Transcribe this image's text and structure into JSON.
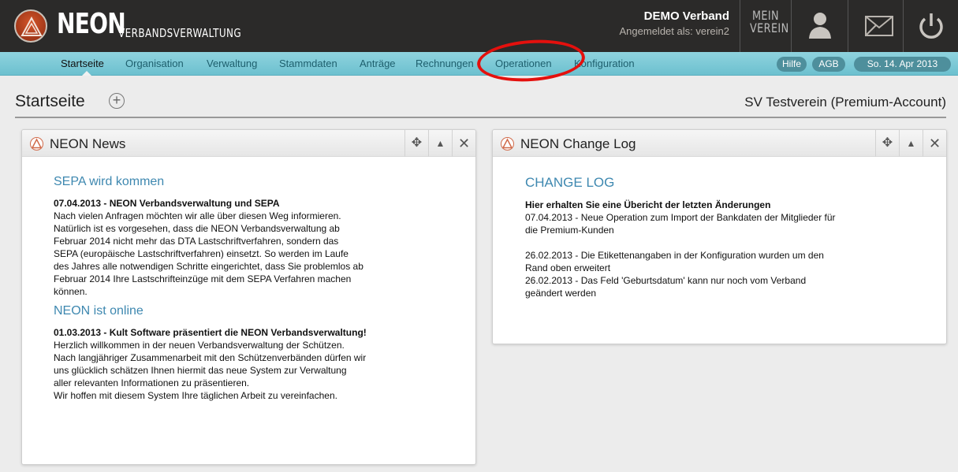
{
  "header": {
    "brand": "NEON",
    "brand_sub": "VERBANDSVERWALTUNG",
    "org_name": "DEMO Verband",
    "login_info": "Angemeldet als: verein2",
    "mein_verein": "MEIN VEREIN",
    "icons": [
      "neon-logo",
      "user-icon",
      "mail-icon",
      "power-icon"
    ]
  },
  "nav": {
    "items": [
      {
        "label": "Startseite",
        "active": true
      },
      {
        "label": "Organisation"
      },
      {
        "label": "Verwaltung"
      },
      {
        "label": "Stammdaten"
      },
      {
        "label": "Anträge"
      },
      {
        "label": "Rechnungen"
      },
      {
        "label": "Operationen"
      },
      {
        "label": "Konfiguration"
      }
    ],
    "help": "Hilfe",
    "agb": "AGB",
    "date": "So. 14. Apr 2013"
  },
  "page": {
    "title": "Startseite",
    "account": "SV Testverein (Premium-Account)"
  },
  "news": {
    "title": "NEON News",
    "posts": [
      {
        "title": "SEPA wird kommen",
        "head": "07.04.2013 - NEON Verbandsverwaltung und SEPA",
        "text": "Nach vielen Anfragen möchten wir alle über diesen Weg informieren.\nNatürlich ist es vorgesehen, dass die NEON Verbandsverwaltung ab\nFebruar 2014 nicht mehr das DTA Lastschriftverfahren, sondern das\nSEPA (europäische Lastschriftverfahren) einsetzt. So werden im Laufe\ndes Jahres alle notwendigen Schritte eingerichtet, dass Sie problemlos ab\nFebruar 2014 Ihre Lastschrifteinzüge mit dem SEPA Verfahren machen\nkönnen."
      },
      {
        "title": "NEON ist online",
        "head": "01.03.2013 - Kult Software präsentiert die NEON Verbandsverwaltung!",
        "text": "Herzlich willkommen in der neuen Verbandsverwaltung der Schützen.\nNach langjähriger Zusammenarbeit mit den Schützenverbänden dürfen wir\nuns glücklich schätzen Ihnen hiermit das neue System zur Verwaltung\naller relevanten Informationen zu präsentieren.\nWir hoffen mit diesem System Ihre täglichen Arbeit zu vereinfachen."
      }
    ]
  },
  "changelog": {
    "title": "NEON Change Log",
    "heading": "CHANGE LOG",
    "intro": "Hier erhalten Sie eine Übericht der letzten Änderungen",
    "entry1": "07.04.2013 - Neue Operation zum Import der Bankdaten der Mitglieder für\ndie Premium-Kunden",
    "entry2": "26.02.2013 - Die Etikettenangaben in der Konfiguration wurden um den\nRand oben erweitert",
    "entry3": "26.02.2013 - Das Feld 'Geburtsdatum' kann nur noch vom Verband\ngeändert werden"
  },
  "widget_controls": {
    "move": "✥",
    "collapse": "▲",
    "close": "✕"
  },
  "colors": {
    "header_bg": "#2b2a29",
    "nav_bg": "#7cc9d6",
    "link": "#3e88b0",
    "annotation": "#e4100d"
  }
}
